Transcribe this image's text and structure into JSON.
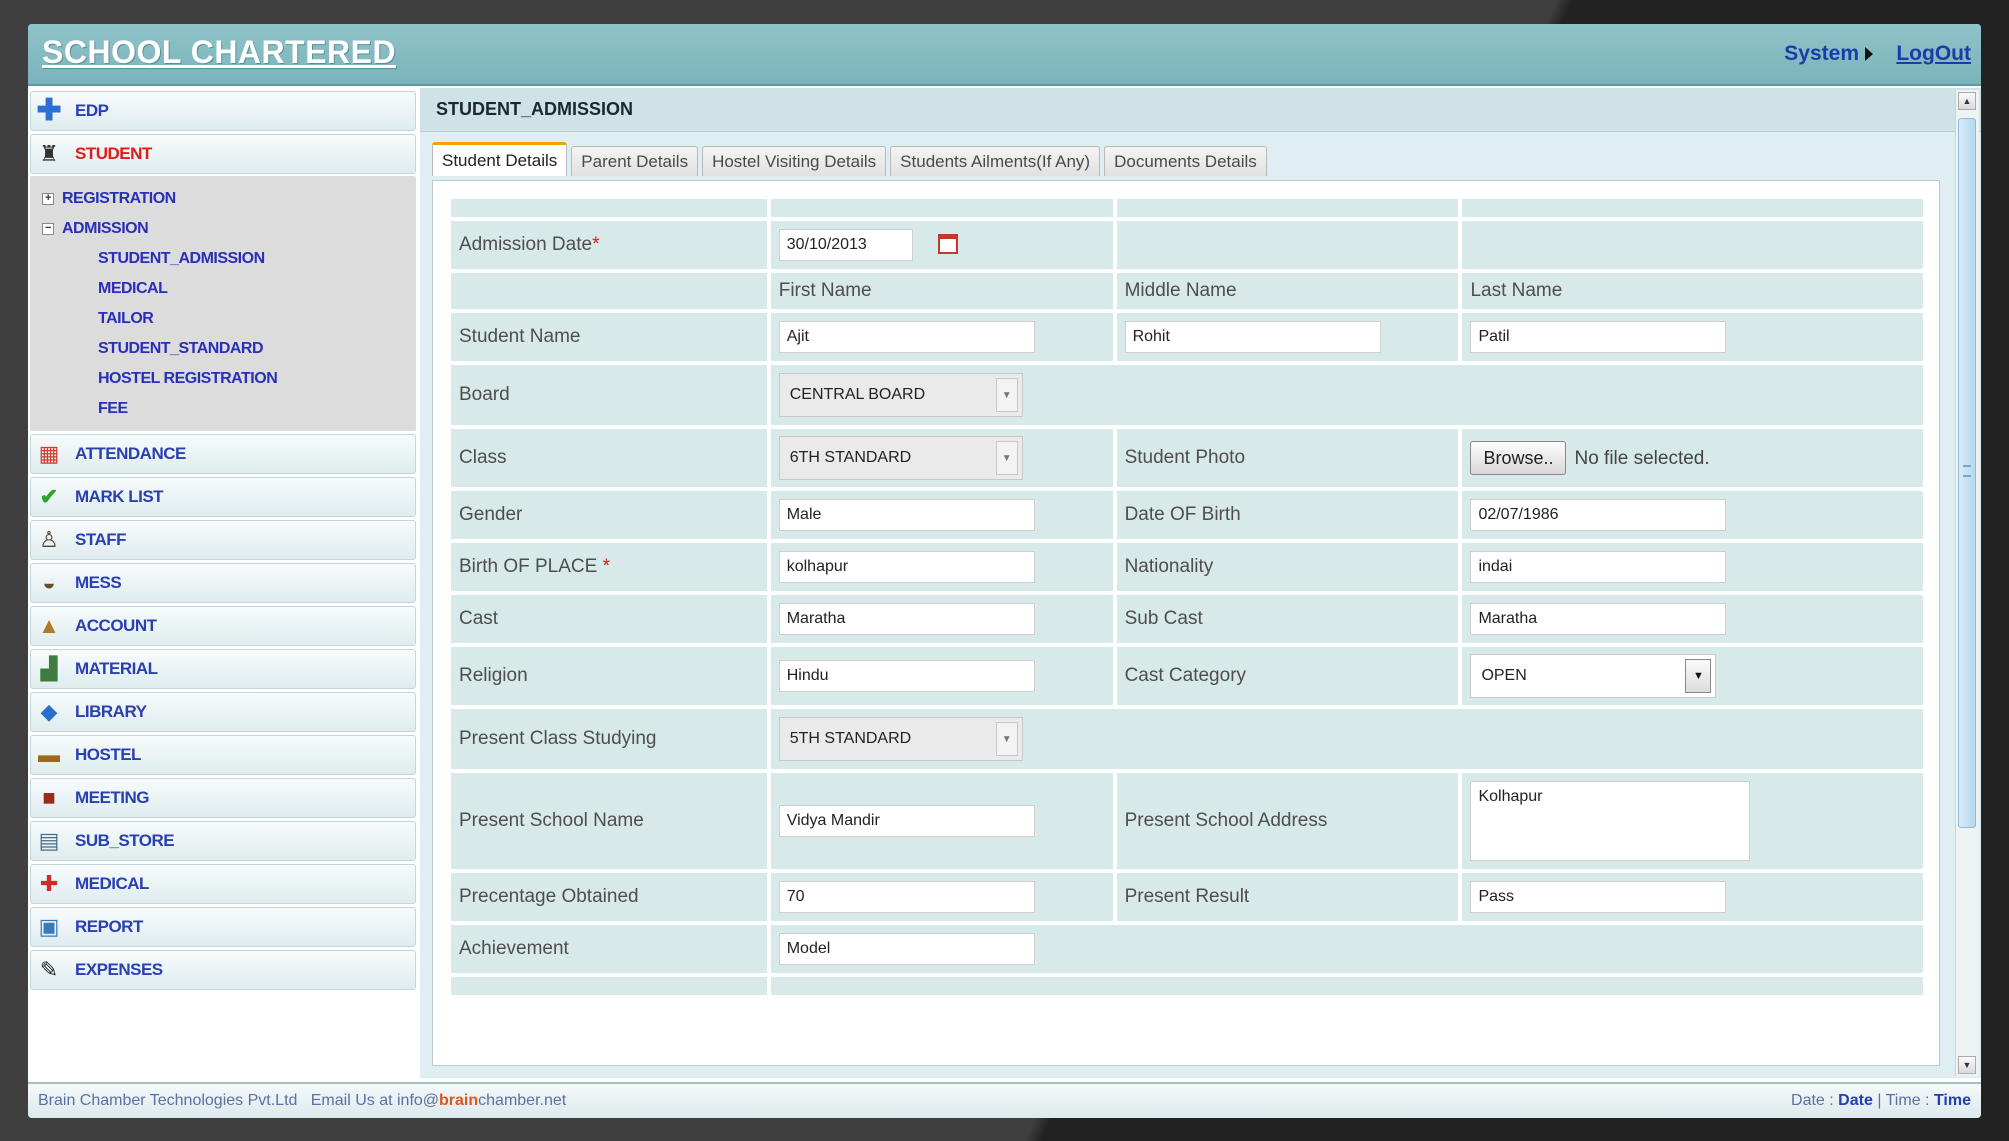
{
  "app": {
    "brand": "SCHOOL CHARTERED"
  },
  "header": {
    "system": "System",
    "logout": "LogOut"
  },
  "sidebar": {
    "items_top": [
      {
        "label": "EDP",
        "icon": "plus-icon"
      },
      {
        "label": "STUDENT",
        "icon": "student-icon",
        "active": true
      }
    ],
    "tree": {
      "registration": "REGISTRATION",
      "admission": "ADMISSION",
      "children": [
        "STUDENT_ADMISSION",
        "MEDICAL",
        "TAILOR",
        "STUDENT_STANDARD",
        "HOSTEL REGISTRATION",
        "FEE"
      ]
    },
    "items_bottom": [
      {
        "label": "ATTENDANCE",
        "icon": "calendar-icon"
      },
      {
        "label": "MARK LIST",
        "icon": "check-icon"
      },
      {
        "label": "STAFF",
        "icon": "staff-icon"
      },
      {
        "label": "MESS",
        "icon": "mess-icon"
      },
      {
        "label": "ACCOUNT",
        "icon": "account-icon"
      },
      {
        "label": "MATERIAL",
        "icon": "material-icon"
      },
      {
        "label": "LIBRARY",
        "icon": "library-icon"
      },
      {
        "label": "HOSTEL",
        "icon": "hostel-icon"
      },
      {
        "label": "MEETING",
        "icon": "meeting-icon"
      },
      {
        "label": "SUB_STORE",
        "icon": "store-icon"
      },
      {
        "label": "MEDICAL",
        "icon": "medical-icon"
      },
      {
        "label": "REPORT",
        "icon": "report-icon"
      },
      {
        "label": "EXPENSES",
        "icon": "expenses-icon"
      }
    ]
  },
  "page": {
    "title": "STUDENT_ADMISSION"
  },
  "tabs": [
    "Student Details",
    "Parent Details",
    "Hostel Visiting Details",
    "Students Ailments(If Any)",
    "Documents Details"
  ],
  "form": {
    "admission_date_label": "Admission Date",
    "admission_date": "30/10/2013",
    "first_name_header": "First Name",
    "middle_name_header": "Middle Name",
    "last_name_header": "Last Name",
    "student_name_label": "Student Name",
    "first_name": "Ajit",
    "middle_name": "Rohit",
    "last_name": "Patil",
    "board_label": "Board",
    "board": "CENTRAL BOARD",
    "class_label": "Class",
    "class": "6TH STANDARD",
    "photo_label": "Student Photo",
    "browse": "Browse..",
    "no_file": "No file selected.",
    "gender_label": "Gender",
    "gender": "Male",
    "dob_label": "Date OF Birth",
    "dob": "02/07/1986",
    "birth_place_label": "Birth OF PLACE",
    "birth_place": "kolhapur",
    "nationality_label": "Nationality",
    "nationality": "indai",
    "cast_label": "Cast",
    "cast": "Maratha",
    "sub_cast_label": "Sub Cast",
    "sub_cast": "Maratha",
    "religion_label": "Religion",
    "religion": "Hindu",
    "cast_category_label": "Cast Category",
    "cast_category": "OPEN",
    "present_class_label": "Present Class Studying",
    "present_class": "5TH STANDARD",
    "school_name_label": "Present School Name",
    "school_name": "Vidya Mandir",
    "school_address_label": "Present School Address",
    "school_address": "Kolhapur",
    "percentage_label": "Precentage Obtained",
    "percentage": "70",
    "result_label": "Present Result",
    "result": "Pass",
    "achievement_label": "Achievement",
    "achievement": "Model",
    "required_mark": "*"
  },
  "footer": {
    "company": "Brain Chamber Technologies Pvt.Ltd",
    "email_prefix": "Email Us at info@",
    "email_brand": "brain",
    "email_suffix": "chamber.net",
    "date_label": "Date :",
    "date_value": "Date",
    "separator": "|",
    "time_label": "Time :",
    "time_value": "Time"
  },
  "colors": {
    "header": "#7ab4bb",
    "link": "#1a3ca8",
    "active": "#e11a1a",
    "panel": "#d8e9ea"
  }
}
